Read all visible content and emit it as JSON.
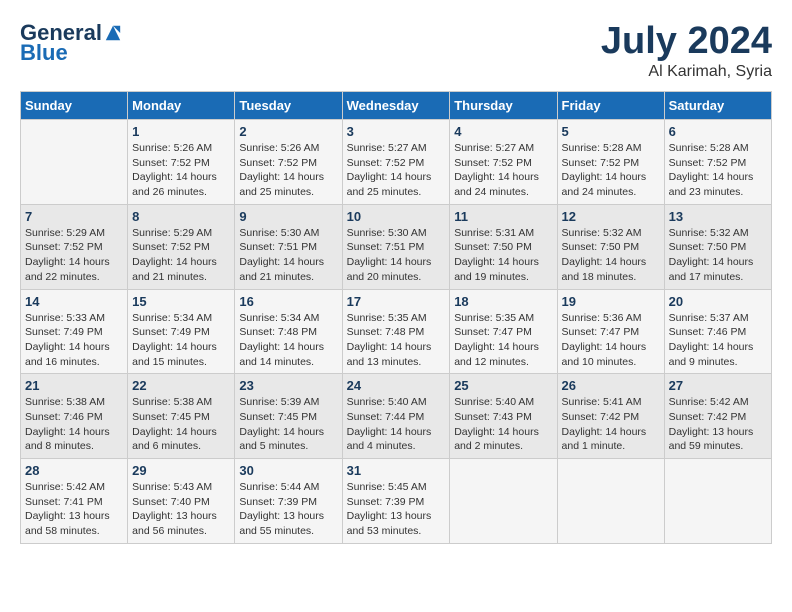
{
  "logo": {
    "general": "General",
    "blue": "Blue"
  },
  "title": {
    "month_year": "July 2024",
    "location": "Al Karimah, Syria"
  },
  "headers": [
    "Sunday",
    "Monday",
    "Tuesday",
    "Wednesday",
    "Thursday",
    "Friday",
    "Saturday"
  ],
  "weeks": [
    [
      {
        "day": "",
        "sunrise": "",
        "sunset": "",
        "daylight": ""
      },
      {
        "day": "1",
        "sunrise": "Sunrise: 5:26 AM",
        "sunset": "Sunset: 7:52 PM",
        "daylight": "Daylight: 14 hours and 26 minutes."
      },
      {
        "day": "2",
        "sunrise": "Sunrise: 5:26 AM",
        "sunset": "Sunset: 7:52 PM",
        "daylight": "Daylight: 14 hours and 25 minutes."
      },
      {
        "day": "3",
        "sunrise": "Sunrise: 5:27 AM",
        "sunset": "Sunset: 7:52 PM",
        "daylight": "Daylight: 14 hours and 25 minutes."
      },
      {
        "day": "4",
        "sunrise": "Sunrise: 5:27 AM",
        "sunset": "Sunset: 7:52 PM",
        "daylight": "Daylight: 14 hours and 24 minutes."
      },
      {
        "day": "5",
        "sunrise": "Sunrise: 5:28 AM",
        "sunset": "Sunset: 7:52 PM",
        "daylight": "Daylight: 14 hours and 24 minutes."
      },
      {
        "day": "6",
        "sunrise": "Sunrise: 5:28 AM",
        "sunset": "Sunset: 7:52 PM",
        "daylight": "Daylight: 14 hours and 23 minutes."
      }
    ],
    [
      {
        "day": "7",
        "sunrise": "Sunrise: 5:29 AM",
        "sunset": "Sunset: 7:52 PM",
        "daylight": "Daylight: 14 hours and 22 minutes."
      },
      {
        "day": "8",
        "sunrise": "Sunrise: 5:29 AM",
        "sunset": "Sunset: 7:52 PM",
        "daylight": "Daylight: 14 hours and 21 minutes."
      },
      {
        "day": "9",
        "sunrise": "Sunrise: 5:30 AM",
        "sunset": "Sunset: 7:51 PM",
        "daylight": "Daylight: 14 hours and 21 minutes."
      },
      {
        "day": "10",
        "sunrise": "Sunrise: 5:30 AM",
        "sunset": "Sunset: 7:51 PM",
        "daylight": "Daylight: 14 hours and 20 minutes."
      },
      {
        "day": "11",
        "sunrise": "Sunrise: 5:31 AM",
        "sunset": "Sunset: 7:50 PM",
        "daylight": "Daylight: 14 hours and 19 minutes."
      },
      {
        "day": "12",
        "sunrise": "Sunrise: 5:32 AM",
        "sunset": "Sunset: 7:50 PM",
        "daylight": "Daylight: 14 hours and 18 minutes."
      },
      {
        "day": "13",
        "sunrise": "Sunrise: 5:32 AM",
        "sunset": "Sunset: 7:50 PM",
        "daylight": "Daylight: 14 hours and 17 minutes."
      }
    ],
    [
      {
        "day": "14",
        "sunrise": "Sunrise: 5:33 AM",
        "sunset": "Sunset: 7:49 PM",
        "daylight": "Daylight: 14 hours and 16 minutes."
      },
      {
        "day": "15",
        "sunrise": "Sunrise: 5:34 AM",
        "sunset": "Sunset: 7:49 PM",
        "daylight": "Daylight: 14 hours and 15 minutes."
      },
      {
        "day": "16",
        "sunrise": "Sunrise: 5:34 AM",
        "sunset": "Sunset: 7:48 PM",
        "daylight": "Daylight: 14 hours and 14 minutes."
      },
      {
        "day": "17",
        "sunrise": "Sunrise: 5:35 AM",
        "sunset": "Sunset: 7:48 PM",
        "daylight": "Daylight: 14 hours and 13 minutes."
      },
      {
        "day": "18",
        "sunrise": "Sunrise: 5:35 AM",
        "sunset": "Sunset: 7:47 PM",
        "daylight": "Daylight: 14 hours and 12 minutes."
      },
      {
        "day": "19",
        "sunrise": "Sunrise: 5:36 AM",
        "sunset": "Sunset: 7:47 PM",
        "daylight": "Daylight: 14 hours and 10 minutes."
      },
      {
        "day": "20",
        "sunrise": "Sunrise: 5:37 AM",
        "sunset": "Sunset: 7:46 PM",
        "daylight": "Daylight: 14 hours and 9 minutes."
      }
    ],
    [
      {
        "day": "21",
        "sunrise": "Sunrise: 5:38 AM",
        "sunset": "Sunset: 7:46 PM",
        "daylight": "Daylight: 14 hours and 8 minutes."
      },
      {
        "day": "22",
        "sunrise": "Sunrise: 5:38 AM",
        "sunset": "Sunset: 7:45 PM",
        "daylight": "Daylight: 14 hours and 6 minutes."
      },
      {
        "day": "23",
        "sunrise": "Sunrise: 5:39 AM",
        "sunset": "Sunset: 7:45 PM",
        "daylight": "Daylight: 14 hours and 5 minutes."
      },
      {
        "day": "24",
        "sunrise": "Sunrise: 5:40 AM",
        "sunset": "Sunset: 7:44 PM",
        "daylight": "Daylight: 14 hours and 4 minutes."
      },
      {
        "day": "25",
        "sunrise": "Sunrise: 5:40 AM",
        "sunset": "Sunset: 7:43 PM",
        "daylight": "Daylight: 14 hours and 2 minutes."
      },
      {
        "day": "26",
        "sunrise": "Sunrise: 5:41 AM",
        "sunset": "Sunset: 7:42 PM",
        "daylight": "Daylight: 14 hours and 1 minute."
      },
      {
        "day": "27",
        "sunrise": "Sunrise: 5:42 AM",
        "sunset": "Sunset: 7:42 PM",
        "daylight": "Daylight: 13 hours and 59 minutes."
      }
    ],
    [
      {
        "day": "28",
        "sunrise": "Sunrise: 5:42 AM",
        "sunset": "Sunset: 7:41 PM",
        "daylight": "Daylight: 13 hours and 58 minutes."
      },
      {
        "day": "29",
        "sunrise": "Sunrise: 5:43 AM",
        "sunset": "Sunset: 7:40 PM",
        "daylight": "Daylight: 13 hours and 56 minutes."
      },
      {
        "day": "30",
        "sunrise": "Sunrise: 5:44 AM",
        "sunset": "Sunset: 7:39 PM",
        "daylight": "Daylight: 13 hours and 55 minutes."
      },
      {
        "day": "31",
        "sunrise": "Sunrise: 5:45 AM",
        "sunset": "Sunset: 7:39 PM",
        "daylight": "Daylight: 13 hours and 53 minutes."
      },
      {
        "day": "",
        "sunrise": "",
        "sunset": "",
        "daylight": ""
      },
      {
        "day": "",
        "sunrise": "",
        "sunset": "",
        "daylight": ""
      },
      {
        "day": "",
        "sunrise": "",
        "sunset": "",
        "daylight": ""
      }
    ]
  ]
}
